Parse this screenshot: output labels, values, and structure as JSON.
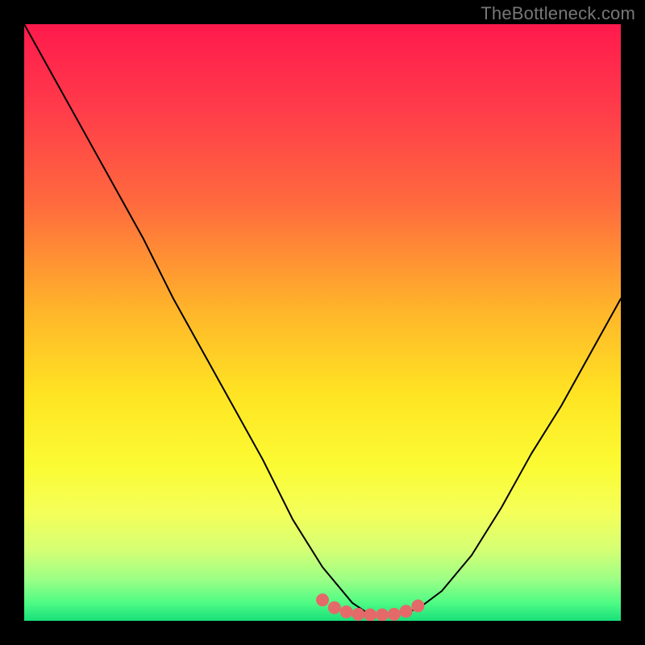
{
  "watermark": "TheBottleneck.com",
  "chart_data": {
    "type": "line",
    "title": "",
    "xlabel": "",
    "ylabel": "",
    "xlim": [
      0,
      100
    ],
    "ylim": [
      0,
      100
    ],
    "grid": false,
    "axes_visible": false,
    "description": "Bottleneck curve over a red-to-green health gradient; valley near x≈58 is the optimal (green) zone",
    "x": [
      0,
      5,
      10,
      15,
      20,
      25,
      30,
      35,
      40,
      45,
      50,
      55,
      58,
      62,
      66,
      70,
      75,
      80,
      85,
      90,
      95,
      100
    ],
    "y": [
      100,
      91,
      82,
      73,
      64,
      54,
      45,
      36,
      27,
      17,
      9,
      3,
      1,
      1,
      2,
      5,
      11,
      19,
      28,
      36,
      45,
      54
    ],
    "marker_points_x": [
      50,
      52,
      54,
      56,
      58,
      60,
      62,
      64,
      66
    ],
    "marker_points_y": [
      3.5,
      2.2,
      1.5,
      1.1,
      1.0,
      1.0,
      1.1,
      1.6,
      2.5
    ],
    "gradient_stops": [
      {
        "pos": 0.0,
        "color": "#ff1a4d"
      },
      {
        "pos": 0.14,
        "color": "#ff3b4a"
      },
      {
        "pos": 0.3,
        "color": "#ff6a3e"
      },
      {
        "pos": 0.48,
        "color": "#ffb52a"
      },
      {
        "pos": 0.62,
        "color": "#ffe423"
      },
      {
        "pos": 0.74,
        "color": "#fbfb33"
      },
      {
        "pos": 0.82,
        "color": "#f4ff5a"
      },
      {
        "pos": 0.88,
        "color": "#d6ff73"
      },
      {
        "pos": 0.93,
        "color": "#9dff86"
      },
      {
        "pos": 0.97,
        "color": "#4efb84"
      },
      {
        "pos": 1.0,
        "color": "#18e07a"
      }
    ],
    "curve_color": "#000000",
    "marker_color": "#e46a6a"
  }
}
